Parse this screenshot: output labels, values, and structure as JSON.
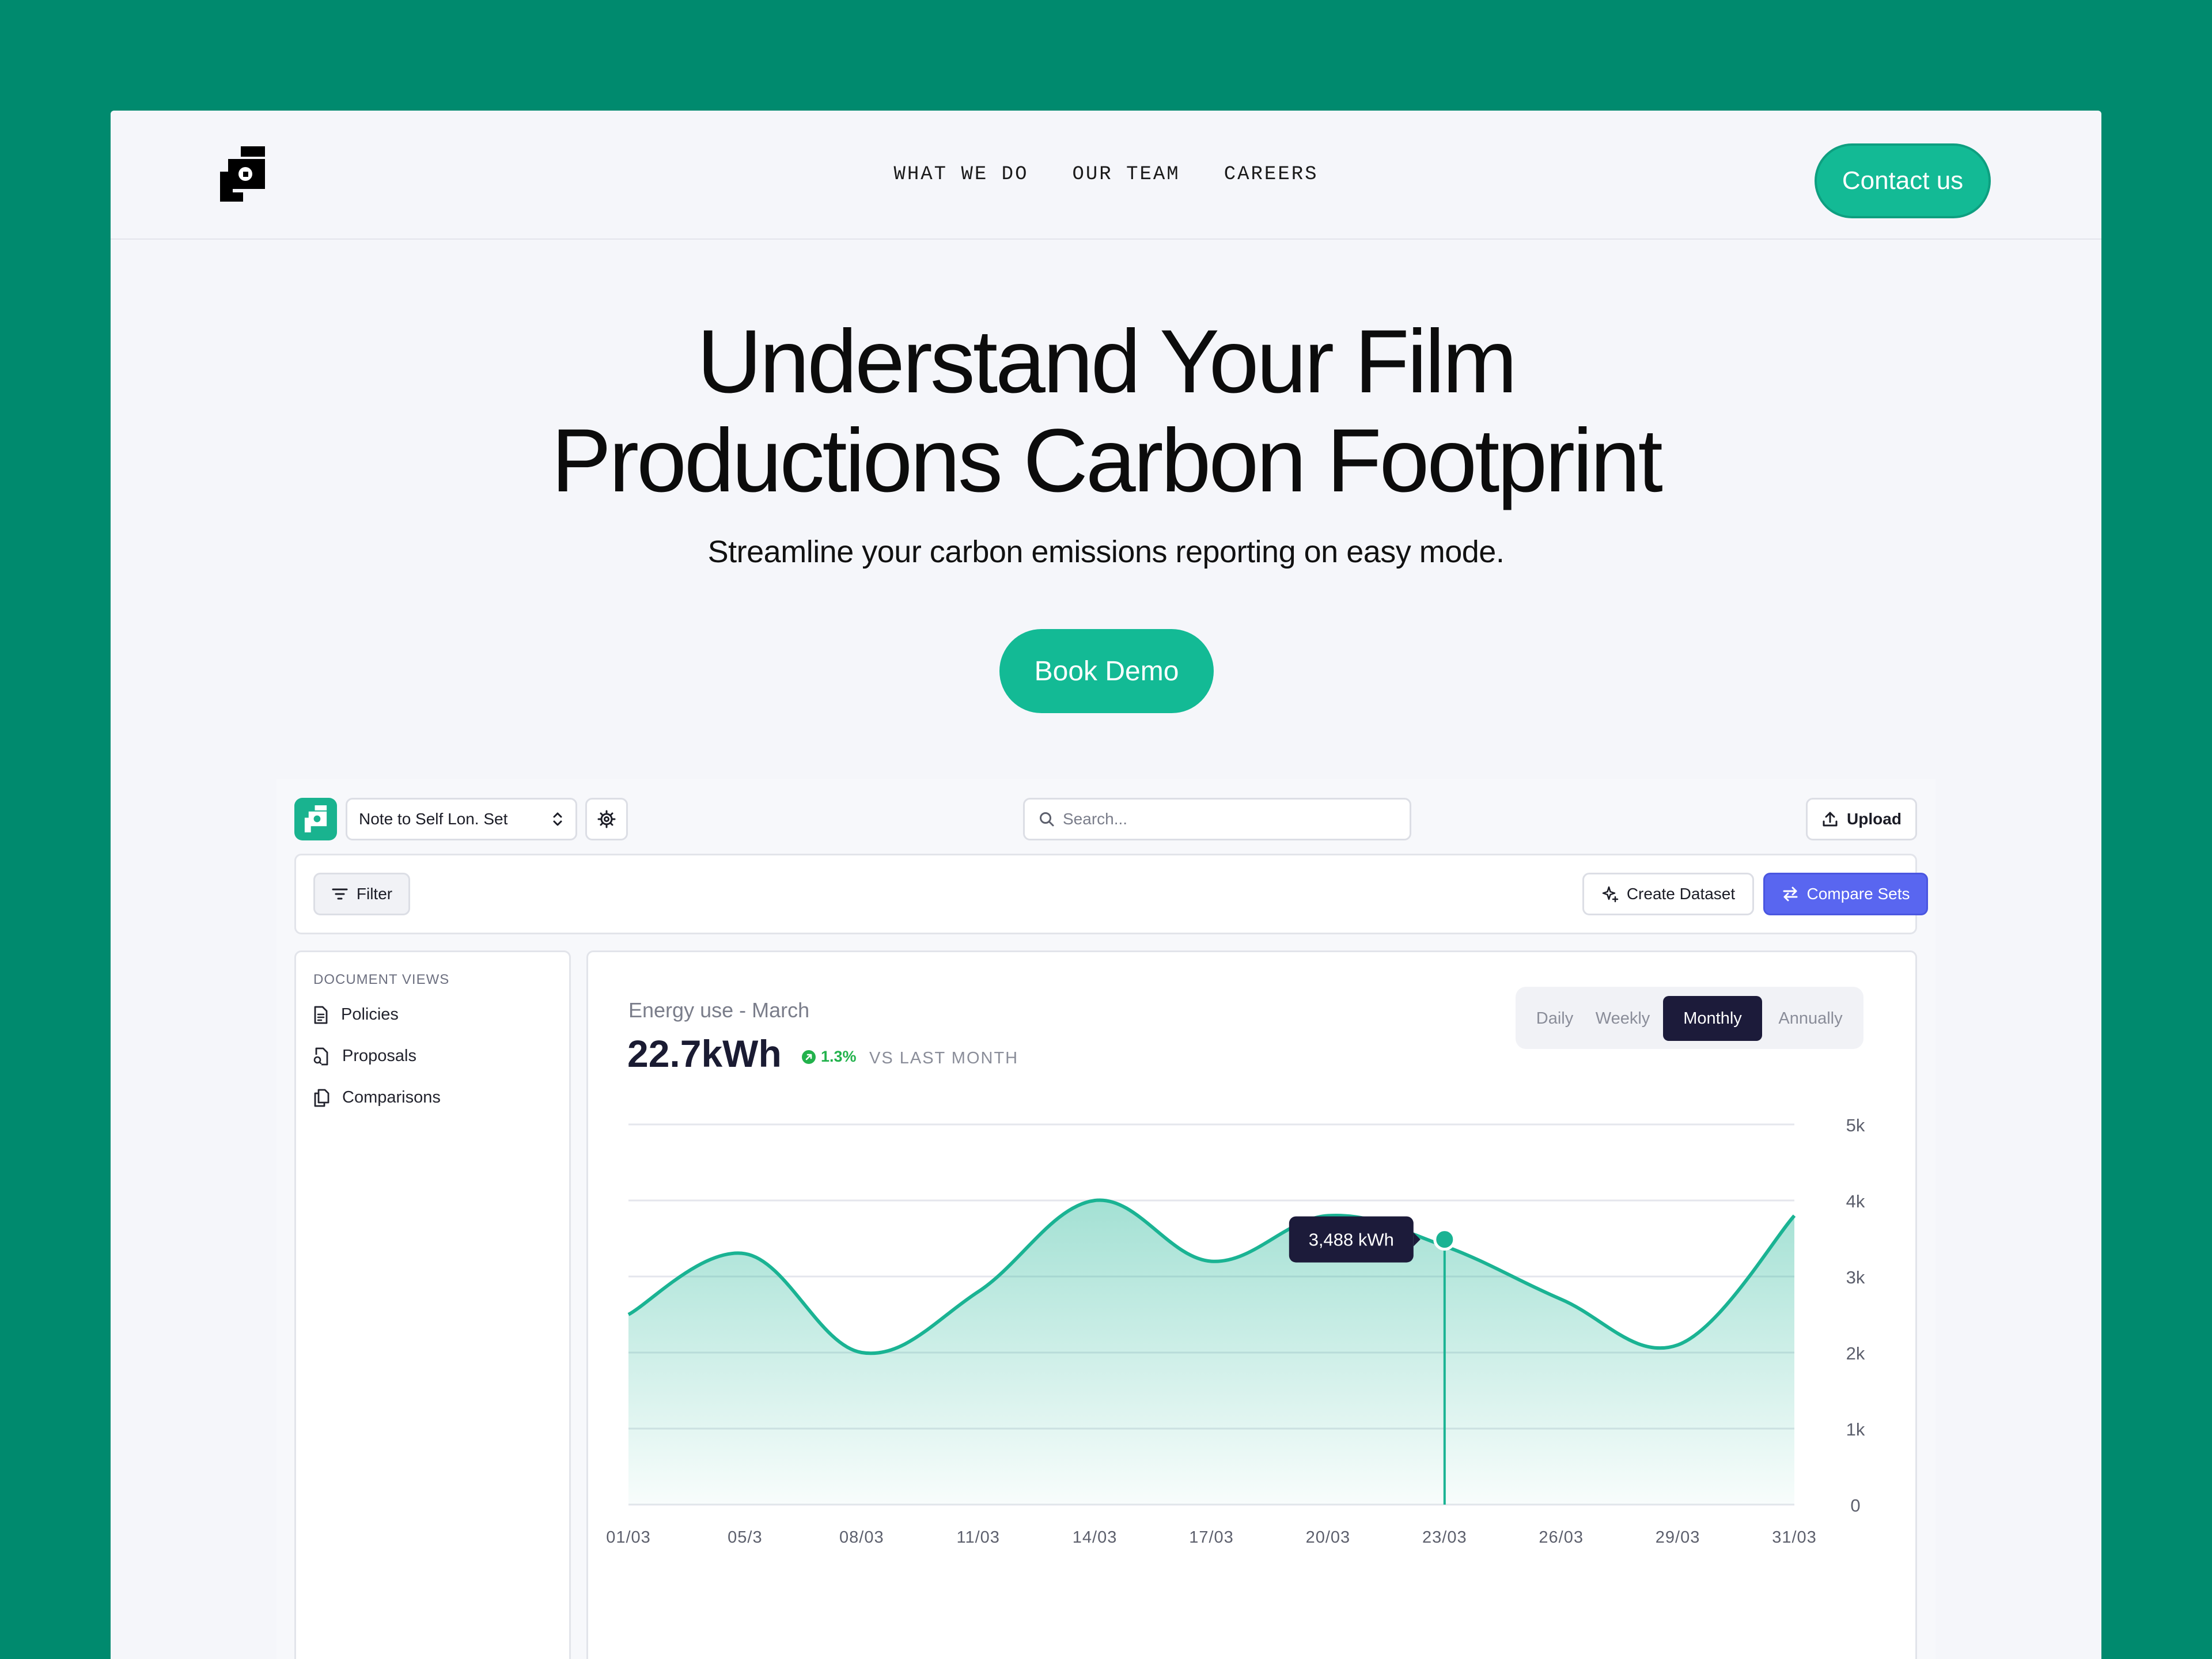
{
  "nav": {
    "links": [
      "WHAT WE DO",
      "OUR TEAM",
      "CAREERS"
    ],
    "contact_label": "Contact us"
  },
  "hero": {
    "title_line1": "Understand Your Film",
    "title_line2": "Productions Carbon Footprint",
    "subtitle": "Streamline your carbon emissions reporting on easy mode.",
    "cta_label": "Book Demo"
  },
  "app": {
    "project_name": "Note to Self Lon. Set",
    "search_placeholder": "Search...",
    "upload_label": "Upload",
    "filter_label": "Filter",
    "create_label": "Create Dataset",
    "compare_label": "Compare Sets",
    "sidebar": {
      "heading": "DOCUMENT VIEWS",
      "items": [
        {
          "label": "Policies",
          "icon": "document-icon"
        },
        {
          "label": "Proposals",
          "icon": "proposal-document-icon"
        },
        {
          "label": "Comparisons",
          "icon": "copy-documents-icon"
        }
      ]
    },
    "chart_header": {
      "label": "Energy use - March",
      "value": "22.7kWh",
      "change": "1.3%",
      "vs": "VS LAST MONTH"
    },
    "periods": [
      "Daily",
      "Weekly",
      "Monthly",
      "Annually"
    ],
    "active_period": "Monthly",
    "tooltip": "3,488 kWh"
  },
  "colors": {
    "accent": "#13ba95",
    "line": "#1ab393",
    "compare_button": "#5966f0",
    "active_tab": "#1c1b3a",
    "background": "#008a6e"
  },
  "chart_data": {
    "type": "area",
    "title": "Energy use - March",
    "x": [
      "01/03",
      "05/3",
      "08/03",
      "11/03",
      "14/03",
      "17/03",
      "20/03",
      "23/03",
      "26/03",
      "29/03",
      "31/03"
    ],
    "series": [
      {
        "values": [
          2500,
          3300,
          2000,
          2800,
          4000,
          3200,
          3800,
          3400,
          2700,
          2100,
          3800
        ]
      }
    ],
    "highlight": {
      "x": "23/03",
      "value": 3488,
      "label": "3,488 kWh"
    },
    "yticks": [
      "0",
      "1k",
      "2k",
      "3k",
      "4k",
      "5k"
    ],
    "ylim": [
      0,
      5000
    ],
    "grid": true,
    "y_axis_position": "right"
  }
}
